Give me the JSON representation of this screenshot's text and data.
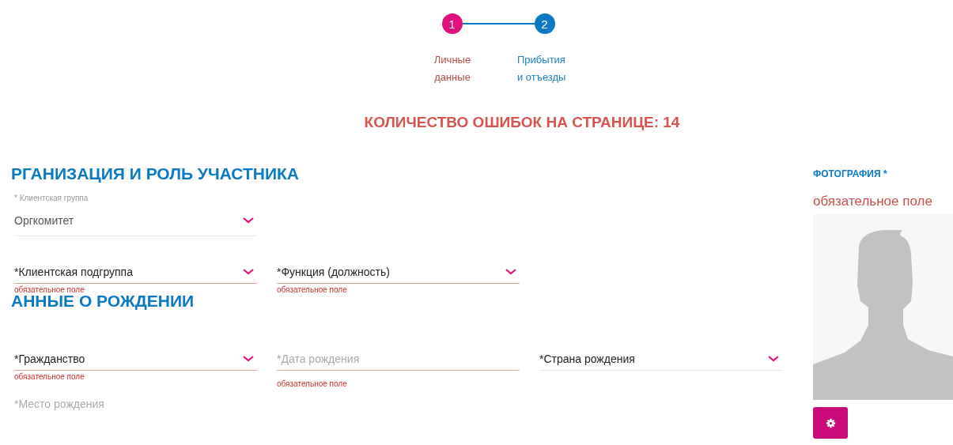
{
  "stepper": {
    "steps": [
      {
        "number": "1",
        "label": "Личные данные",
        "selected": true
      },
      {
        "number": "2",
        "label": "Прибытия и отъезды",
        "selected": false
      }
    ]
  },
  "error_summary": "КОЛИЧЕСТВО ОШИБОК НА СТРАНИЦЕ: 14",
  "sections": [
    {
      "title": "РГАНИЗАЦИЯ И РОЛЬ УЧАСТНИКА",
      "rows": [
        [
          {
            "kind": "select",
            "label": "* Клиентская группа",
            "value": "Оргкомитет"
          }
        ],
        [
          {
            "kind": "select",
            "value": "*Клиентская подгруппа",
            "error": "обязательное поле"
          },
          {
            "kind": "select",
            "value": "*Функция (должность)",
            "error": "обязательное поле"
          }
        ]
      ]
    },
    {
      "title": "АННЫЕ О РОЖДЕНИИ",
      "rows": [
        [
          {
            "kind": "select",
            "value": "*Гражданство",
            "error": "обязательное поле"
          },
          {
            "kind": "text",
            "placeholder": "*Дата рождения",
            "error": "обязательное поле"
          },
          {
            "kind": "select",
            "value": "*Страна рождения"
          }
        ],
        [
          {
            "kind": "text",
            "placeholder": "*Место рождения"
          }
        ]
      ]
    }
  ],
  "photo": {
    "title": "ФОТОГРАФИЯ *",
    "error": "обязательное поле",
    "kind": "picture",
    "button": {
      "kind": "settings"
    }
  }
}
